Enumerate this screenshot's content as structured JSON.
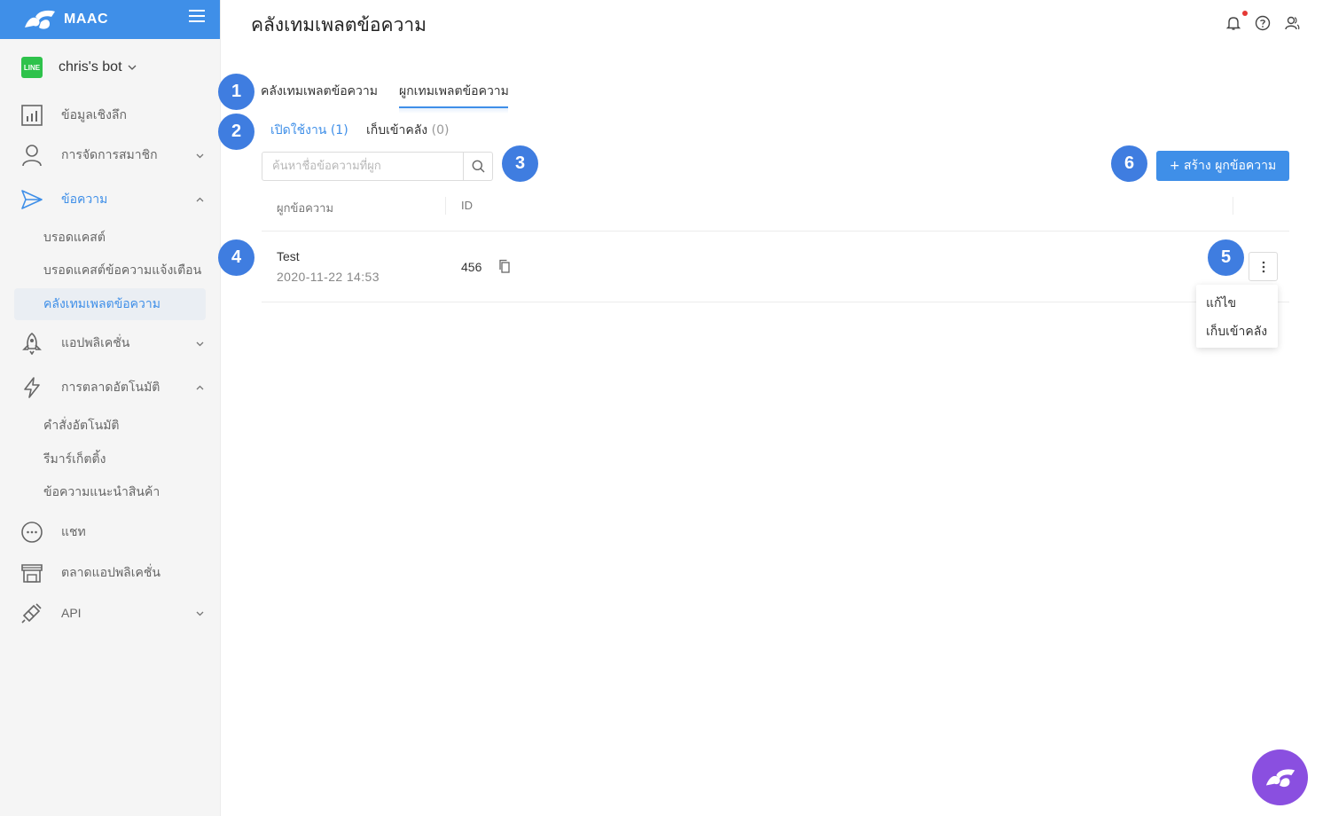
{
  "app": {
    "brand_name": "MAAC",
    "bot_name": "chris's bot",
    "line_badge": "LINE"
  },
  "sidebar": {
    "items": [
      {
        "label": "ข้อมูลเชิงลึก",
        "icon": "bar-chart-icon"
      },
      {
        "label": "การจัดการสมาชิก",
        "icon": "user-icon"
      },
      {
        "label": "ข้อความ",
        "icon": "send-icon"
      },
      {
        "label": "แอปพลิเคชั่น",
        "icon": "rocket-icon"
      },
      {
        "label": "การตลาดอัตโนมัติ",
        "icon": "lightning-icon"
      },
      {
        "label": "แชท",
        "icon": "chat-icon"
      },
      {
        "label": "ตลาดแอปพลิเคชั่น",
        "icon": "store-icon"
      },
      {
        "label": "API",
        "icon": "plug-icon"
      }
    ],
    "message_sub": [
      "บรอดแคสต์",
      "บรอดแคสต์ข้อความแจ้งเตือน",
      "คลังเทมเพลตข้อความ"
    ],
    "automation_sub": [
      "คำสั่งอัตโนมัติ",
      "รีมาร์เก็ตติ้ง",
      "ข้อความแนะนำสินค้า"
    ]
  },
  "header": {
    "title": "คลังเทมเพลตข้อความ"
  },
  "tabs": [
    "คลังเทมเพลตข้อความ",
    "ผูกเทมเพลตข้อความ"
  ],
  "subtabs": [
    {
      "label": "เปิดใช้งาน",
      "count": "(1)"
    },
    {
      "label": "เก็บเข้าคลัง",
      "count": "(0)"
    }
  ],
  "search": {
    "placeholder": "ค้นหาชื่อข้อความที่ผูก"
  },
  "create_button": "+ สร้าง ผูกข้อความ",
  "table": {
    "columns": [
      "ผูกข้อความ",
      "ID"
    ],
    "rows": [
      {
        "name": "Test",
        "date": "2020-11-22 14:53",
        "id": "456"
      }
    ]
  },
  "menu": [
    "แก้ไข",
    "เก็บเข้าคลัง"
  ],
  "markers": [
    "1",
    "2",
    "3",
    "4",
    "5",
    "6"
  ],
  "colors": {
    "primary": "#3f8fe8",
    "marker": "#3f7de0",
    "fab": "#8a4fe0"
  }
}
